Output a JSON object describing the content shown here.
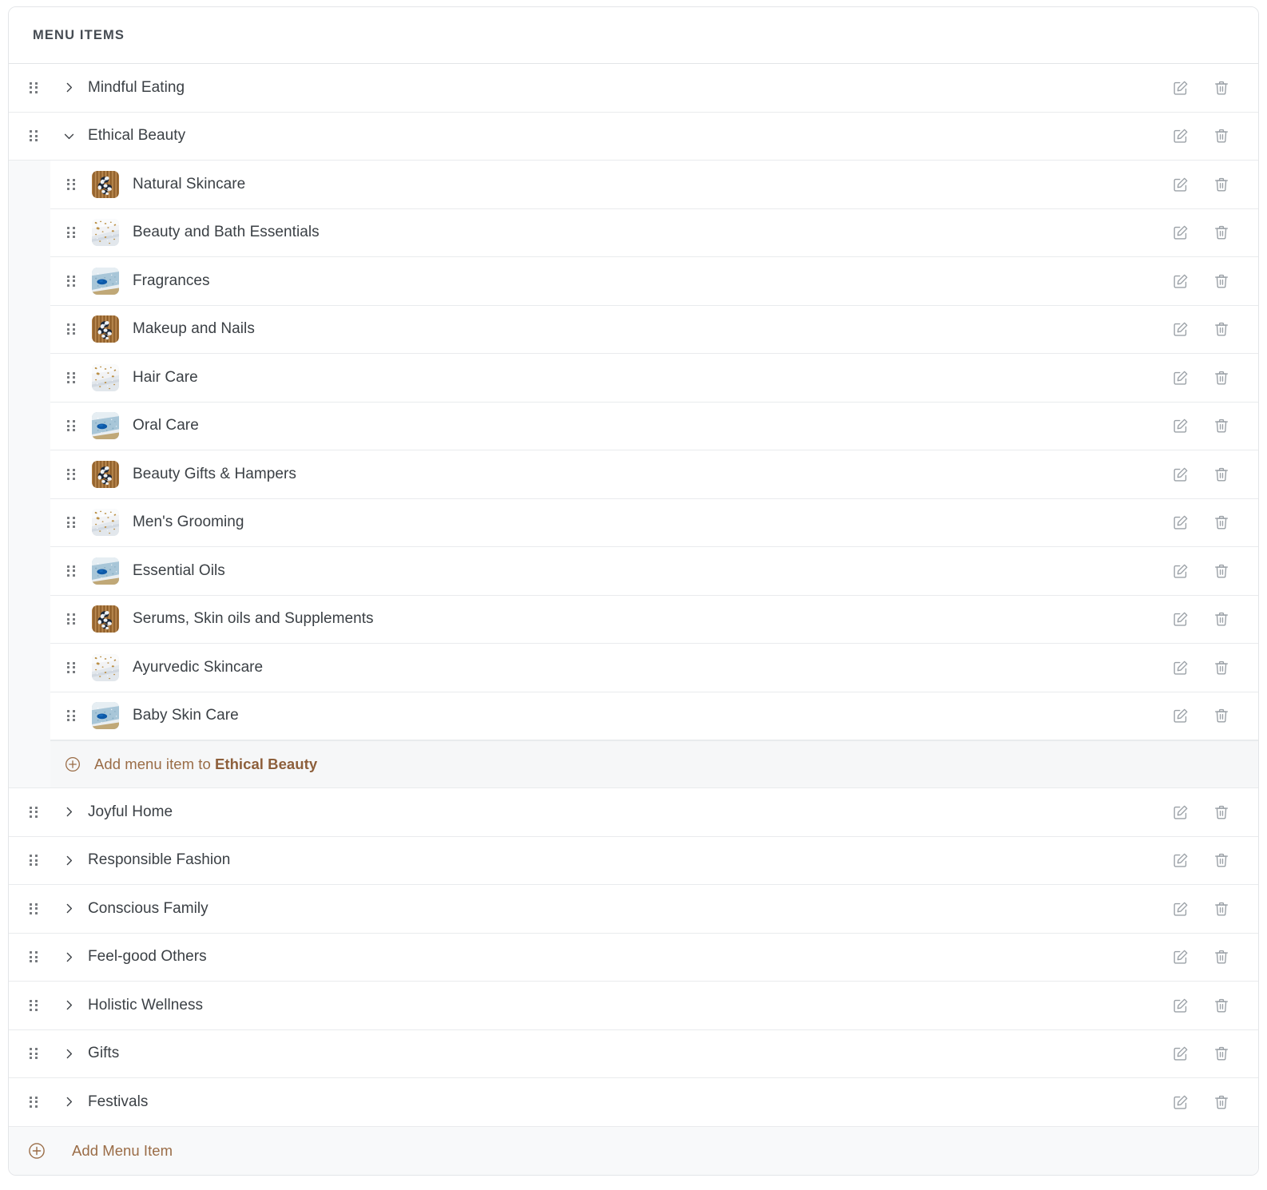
{
  "panel": {
    "title": "MENU ITEMS",
    "accent_color": "#9a6c46",
    "text_color": "#3b4045",
    "border_color": "#e9ebed"
  },
  "actions": {
    "edit_label": "Edit",
    "delete_label": "Delete",
    "edit_icon": "edit-pencil-square-icon",
    "delete_icon": "trash-can-icon",
    "drag_icon": "drag-handle-icon",
    "expand_icon": "chevron-right-icon",
    "collapse_icon": "chevron-down-icon",
    "add_icon": "plus-circle-icon"
  },
  "menu_items": [
    {
      "label": "Mindful Eating",
      "expanded": false
    },
    {
      "label": "Ethical Beauty",
      "expanded": true
    },
    {
      "label": "Joyful Home",
      "expanded": false
    },
    {
      "label": "Responsible Fashion",
      "expanded": false
    },
    {
      "label": "Conscious Family",
      "expanded": false
    },
    {
      "label": "Feel-good Others",
      "expanded": false
    },
    {
      "label": "Holistic Wellness",
      "expanded": false
    },
    {
      "label": "Gifts",
      "expanded": false
    },
    {
      "label": "Festivals",
      "expanded": false
    }
  ],
  "expanded_group": {
    "parent_label": "Ethical Beauty",
    "children": [
      {
        "label": "Natural Skincare",
        "thumb": "wood-flowers"
      },
      {
        "label": "Beauty and Bath Essentials",
        "thumb": "white-gold-marble"
      },
      {
        "label": "Fragrances",
        "thumb": "blue-teal-blob"
      },
      {
        "label": "Makeup and Nails",
        "thumb": "wood-flowers"
      },
      {
        "label": "Hair Care",
        "thumb": "white-gold-marble"
      },
      {
        "label": "Oral Care",
        "thumb": "blue-teal-blob"
      },
      {
        "label": "Beauty Gifts & Hampers",
        "thumb": "wood-flowers"
      },
      {
        "label": "Men's Grooming",
        "thumb": "white-gold-marble"
      },
      {
        "label": "Essential Oils",
        "thumb": "blue-teal-blob"
      },
      {
        "label": "Serums, Skin oils and Supplements",
        "thumb": "wood-flowers"
      },
      {
        "label": "Ayurvedic Skincare",
        "thumb": "white-gold-marble"
      },
      {
        "label": "Baby Skin Care",
        "thumb": "blue-teal-blob"
      }
    ],
    "add_prefix": "Add menu item to ",
    "add_target": "Ethical Beauty"
  },
  "footer": {
    "add_label": "Add Menu Item"
  }
}
